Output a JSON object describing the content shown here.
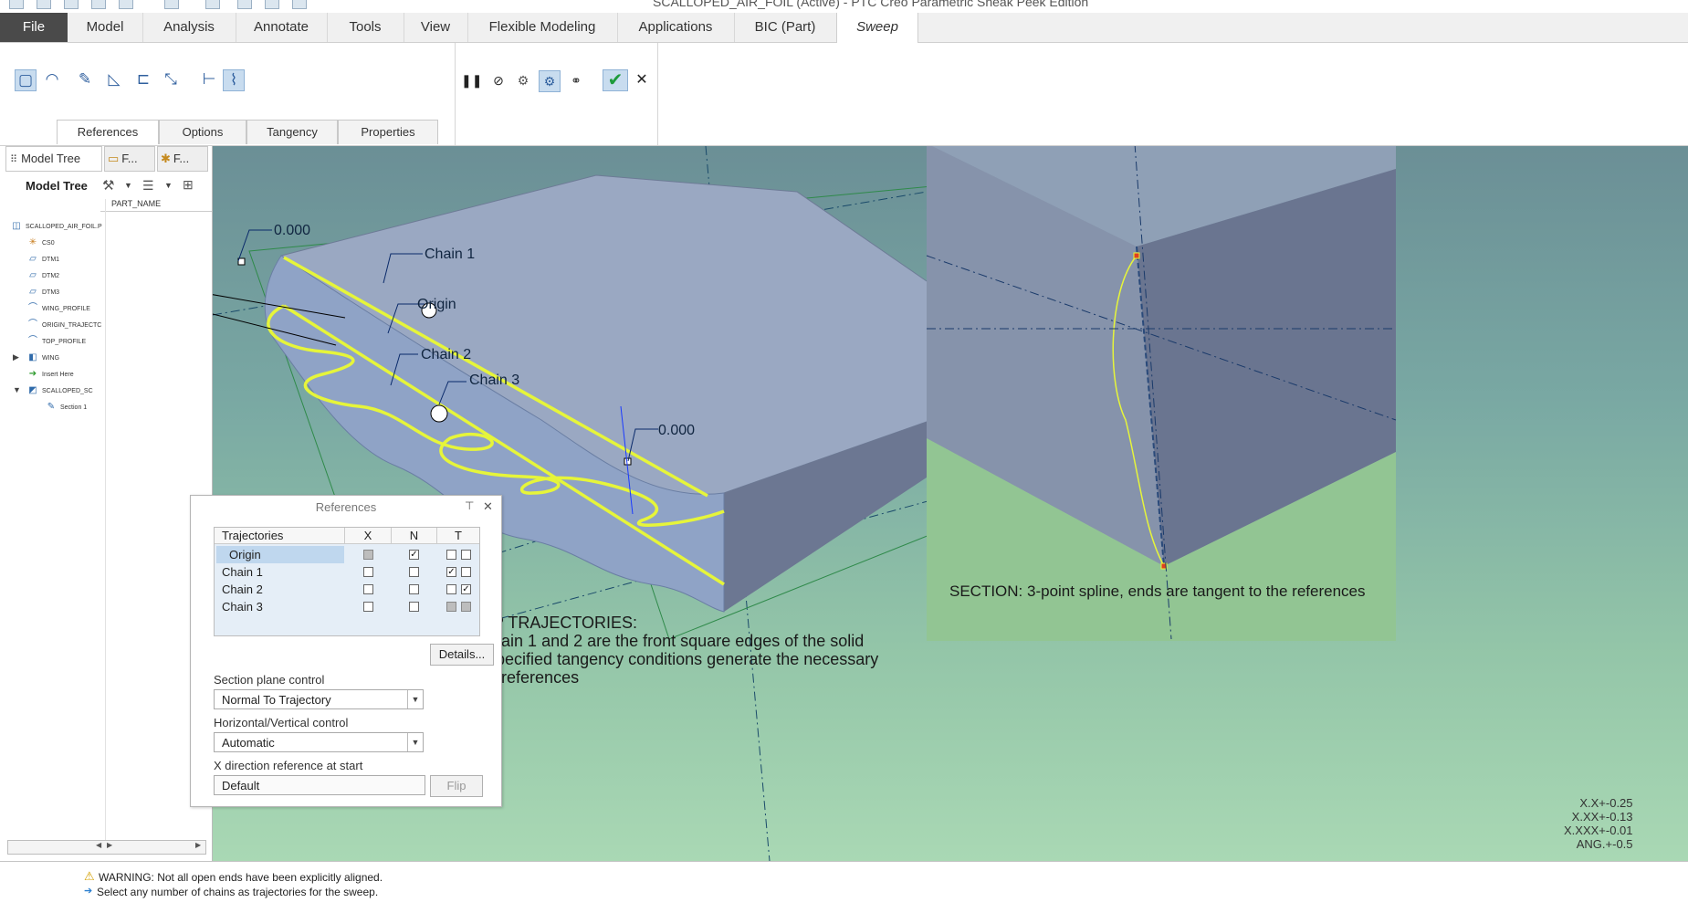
{
  "window": {
    "title": "SCALLOPED_AIR_FOIL (Active) - PTC Creo Parametric Sneak Peek Edition"
  },
  "ribbon_tabs": [
    {
      "label": "File"
    },
    {
      "label": "Model"
    },
    {
      "label": "Analysis"
    },
    {
      "label": "Annotate"
    },
    {
      "label": "Tools"
    },
    {
      "label": "View"
    },
    {
      "label": "Flexible Modeling"
    },
    {
      "label": "Applications"
    },
    {
      "label": "BIC (Part)"
    },
    {
      "label": "Sweep"
    }
  ],
  "sweep_tabs": [
    {
      "label": "References"
    },
    {
      "label": "Options"
    },
    {
      "label": "Tangency"
    },
    {
      "label": "Properties"
    }
  ],
  "left_panel": {
    "tabs": [
      {
        "label": "Model Tree"
      },
      {
        "label": "F..."
      },
      {
        "label": "F..."
      }
    ],
    "heading": "Model Tree",
    "column": "PART_NAME",
    "nodes": [
      {
        "label": "SCALLOPED_AIR_FOIL.P",
        "icon": "part-icon"
      },
      {
        "label": "CS0",
        "icon": "csys-icon"
      },
      {
        "label": "DTM1",
        "icon": "datum-plane-icon"
      },
      {
        "label": "DTM2",
        "icon": "datum-plane-icon"
      },
      {
        "label": "DTM3",
        "icon": "datum-plane-icon"
      },
      {
        "label": "WING_PROFILE",
        "icon": "sketch-icon"
      },
      {
        "label": "ORIGIN_TRAJECTC",
        "icon": "sketch-icon"
      },
      {
        "label": "TOP_PROFILE",
        "icon": "sketch-icon"
      },
      {
        "label": "WING",
        "icon": "extrude-icon"
      },
      {
        "label": "Insert Here",
        "icon": "insert-arrow-icon"
      },
      {
        "label": "SCALLOPED_SC",
        "icon": "sweep-icon"
      },
      {
        "label": "Section 1",
        "icon": "section-icon"
      }
    ]
  },
  "viewport": {
    "labels": {
      "dim_top": "0.000",
      "dim_bottom": "0.000",
      "chain1": "Chain 1",
      "origin": "Origin",
      "chain2": "Chain 2",
      "chain3": "Chain 3"
    },
    "note_title": "SWEEP TRAJECTORIES:",
    "note_lines": [
      "Note chain 1 and 2 are the front square edges of the solid",
      "wing; specified tangency conditions generate the necessary",
      "section references"
    ],
    "section_note": "SECTION: 3-point spline, ends are tangent to the references",
    "tolerances": [
      "X.X+-0.25",
      "X.XX+-0.13",
      "X.XXX+-0.01",
      "ANG.+-0.5"
    ]
  },
  "references_dialog": {
    "title": "References",
    "headers": {
      "name": "Trajectories",
      "x": "X",
      "n": "N",
      "t": "T"
    },
    "rows": [
      {
        "name": "Origin",
        "x": "checked-gray",
        "n": true,
        "t1": false,
        "t2": false
      },
      {
        "name": "Chain 1",
        "x": false,
        "n": false,
        "t1": true,
        "t2": false
      },
      {
        "name": "Chain 2",
        "x": false,
        "n": false,
        "t1": false,
        "t2": true
      },
      {
        "name": "Chain 3",
        "x": false,
        "n": false,
        "t1": false,
        "t2": false
      }
    ],
    "details_label": "Details...",
    "section_plane_label": "Section plane control",
    "section_plane_value": "Normal To Trajectory",
    "hv_label": "Horizontal/Vertical control",
    "hv_value": "Automatic",
    "xdir_label": "X direction reference at start",
    "xdir_value": "Default",
    "flip_label": "Flip"
  },
  "status": {
    "messages": [
      "WARNING: Not all open ends have been explicitly aligned.",
      "Select any number of chains as trajectories for the sweep."
    ]
  },
  "colors": {
    "trajectory": "#e6f53a",
    "solid": "#9aa8c2",
    "accent": "#2f6aaa"
  }
}
